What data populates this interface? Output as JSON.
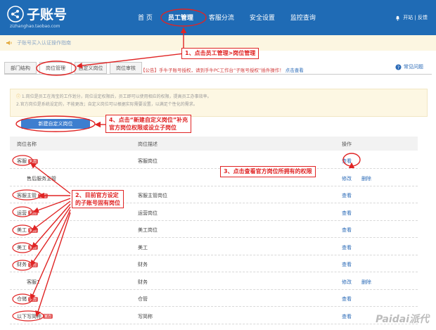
{
  "header": {
    "logo_title": "子账号",
    "logo_sub": "zizhanghao.taobao.com",
    "nav": [
      "首 页",
      "员工管理",
      "客服分流",
      "安全设置",
      "监控查询"
    ],
    "top_right": "开站 | 反馈"
  },
  "notice": "子账号买入认证操作指南",
  "tabs": [
    "部门结构",
    "岗位管理",
    "自定义岗位",
    "岗位审核"
  ],
  "announce": {
    "prefix": "【公告】",
    "text": "手牛子账号授权，请到手牛PC工作台“子账号授权”插件操作！",
    "link": "点击查看"
  },
  "help": "常见问题",
  "tips": [
    "1.岗位是员工在淘宝的工作划分，岗位设定权限后，员工即可以使用相应的权限，提高员工办事效率。",
    "2.官方岗位是系统设定的，不能更改；自定义岗位可以根据实际需要设置，以满足个性化的需求。"
  ],
  "new_button": "新建自定义岗位",
  "table": {
    "headers": [
      "岗位名称",
      "岗位描述",
      "操作"
    ],
    "rows": [
      {
        "name": "客服",
        "badge": "官方",
        "desc": "客服岗位",
        "ops": [
          "查看"
        ]
      },
      {
        "name": "售后服务主管",
        "badge": "",
        "desc": "",
        "ops": [
          "修改",
          "删除"
        ],
        "sub": true
      },
      {
        "name": "客服主管",
        "badge": "官方",
        "desc": "客服主管岗位",
        "ops": [
          "查看"
        ]
      },
      {
        "name": "运营",
        "badge": "官方",
        "desc": "运营岗位",
        "ops": [
          "查看"
        ]
      },
      {
        "name": "美工",
        "badge": "官方",
        "desc": "美工岗位",
        "ops": [
          "查看"
        ]
      },
      {
        "name": "美工",
        "badge": "官方",
        "desc": "美工",
        "ops": [
          "查看"
        ]
      },
      {
        "name": "财务",
        "badge": "官方",
        "desc": "财务",
        "ops": [
          "查看"
        ]
      },
      {
        "name": "客服1",
        "badge": "",
        "desc": "财务",
        "ops": [
          "修改",
          "删除"
        ],
        "sub": true
      },
      {
        "name": "仓储",
        "badge": "官方",
        "desc": "仓管",
        "ops": [
          "查看"
        ]
      },
      {
        "name": "以下写简称",
        "badge": "官方",
        "desc": "写简称",
        "ops": [
          "查看"
        ]
      }
    ]
  },
  "annotations": {
    "a1": "1、点击员工管理>岗位管理",
    "a2_line1": "2、目前官方设定",
    "a2_line2": "的子账号固有岗位",
    "a3": "3、点击查看官方岗位所拥有的权限",
    "a4_line1": "4、点击“新建自定义岗位”补充",
    "a4_line2": "官方岗位权限或设立子岗位"
  },
  "watermark": "Paidai派代",
  "colors": {
    "header": "#1f6bb5",
    "annotation": "#e02424",
    "link": "#2a6ab7"
  }
}
